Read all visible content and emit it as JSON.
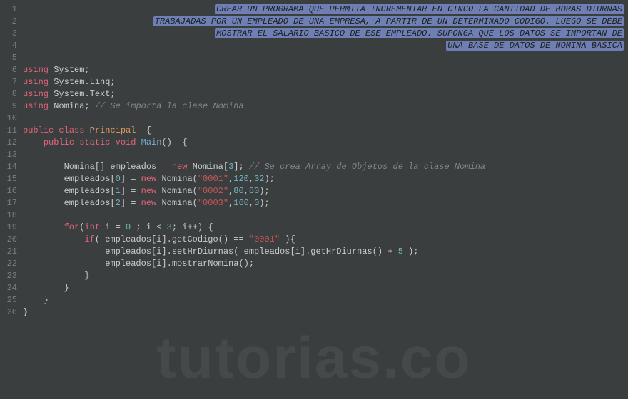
{
  "watermark": "tutorias.co",
  "lines": [
    {
      "num": "1",
      "type": "hl",
      "text": "CREAR UN PROGRAMA QUE PERMITA INCREMENTAR EN CINCO LA CANTIDAD DE HORAS DIURNAS"
    },
    {
      "num": "2",
      "type": "hl",
      "text": "TRABAJADAS POR UN EMPLEADO DE UNA EMPRESA, A PARTIR DE UN DETERMINADO CODIGO. LUEGO SE DEBE"
    },
    {
      "num": "3",
      "type": "hl",
      "text": "MOSTRAR EL SALARIO BASICO DE ESE EMPLEADO. SUPONGA QUE LOS DATOS SE IMPORTAN DE"
    },
    {
      "num": "4",
      "type": "hl",
      "text": "UNA BASE DE DATOS DE NOMINA BASICA"
    },
    {
      "num": "5",
      "type": "blank"
    },
    {
      "num": "6",
      "type": "code",
      "tokens": [
        {
          "c": "keyword",
          "t": "using"
        },
        {
          "c": "plain",
          "t": " System;"
        }
      ]
    },
    {
      "num": "7",
      "type": "code",
      "tokens": [
        {
          "c": "keyword",
          "t": "using"
        },
        {
          "c": "plain",
          "t": " System.Linq;"
        }
      ]
    },
    {
      "num": "8",
      "type": "code",
      "tokens": [
        {
          "c": "keyword",
          "t": "using"
        },
        {
          "c": "plain",
          "t": " System.Text;"
        }
      ]
    },
    {
      "num": "9",
      "type": "code",
      "tokens": [
        {
          "c": "keyword",
          "t": "using"
        },
        {
          "c": "plain",
          "t": " Nomina; "
        },
        {
          "c": "comment",
          "t": "// Se importa la clase Nomina"
        }
      ]
    },
    {
      "num": "10",
      "type": "blank"
    },
    {
      "num": "11",
      "type": "code",
      "tokens": [
        {
          "c": "keyword",
          "t": "public"
        },
        {
          "c": "plain",
          "t": " "
        },
        {
          "c": "keyword",
          "t": "class"
        },
        {
          "c": "plain",
          "t": " "
        },
        {
          "c": "class-name",
          "t": "Principal"
        },
        {
          "c": "plain",
          "t": "  {"
        }
      ]
    },
    {
      "num": "12",
      "type": "code",
      "tokens": [
        {
          "c": "plain",
          "t": "    "
        },
        {
          "c": "keyword",
          "t": "public"
        },
        {
          "c": "plain",
          "t": " "
        },
        {
          "c": "keyword",
          "t": "static"
        },
        {
          "c": "plain",
          "t": " "
        },
        {
          "c": "type",
          "t": "void"
        },
        {
          "c": "plain",
          "t": " "
        },
        {
          "c": "method-name",
          "t": "Main"
        },
        {
          "c": "plain",
          "t": "()  {"
        }
      ]
    },
    {
      "num": "13",
      "type": "blank"
    },
    {
      "num": "14",
      "type": "code",
      "tokens": [
        {
          "c": "plain",
          "t": "        Nomina[] empleados = "
        },
        {
          "c": "keyword",
          "t": "new"
        },
        {
          "c": "plain",
          "t": " Nomina["
        },
        {
          "c": "number",
          "t": "3"
        },
        {
          "c": "plain",
          "t": "]; "
        },
        {
          "c": "comment",
          "t": "// Se crea Array de Objetos de la clase Nomina"
        }
      ]
    },
    {
      "num": "15",
      "type": "code",
      "tokens": [
        {
          "c": "plain",
          "t": "        empleados["
        },
        {
          "c": "number",
          "t": "0"
        },
        {
          "c": "plain",
          "t": "] = "
        },
        {
          "c": "keyword",
          "t": "new"
        },
        {
          "c": "plain",
          "t": " Nomina("
        },
        {
          "c": "string",
          "t": "\"0001\""
        },
        {
          "c": "plain",
          "t": ","
        },
        {
          "c": "number",
          "t": "120"
        },
        {
          "c": "plain",
          "t": ","
        },
        {
          "c": "number",
          "t": "32"
        },
        {
          "c": "plain",
          "t": ");"
        }
      ]
    },
    {
      "num": "16",
      "type": "code",
      "tokens": [
        {
          "c": "plain",
          "t": "        empleados["
        },
        {
          "c": "number",
          "t": "1"
        },
        {
          "c": "plain",
          "t": "] = "
        },
        {
          "c": "keyword",
          "t": "new"
        },
        {
          "c": "plain",
          "t": " Nomina("
        },
        {
          "c": "string",
          "t": "\"0002\""
        },
        {
          "c": "plain",
          "t": ","
        },
        {
          "c": "number",
          "t": "80"
        },
        {
          "c": "plain",
          "t": ","
        },
        {
          "c": "number",
          "t": "80"
        },
        {
          "c": "plain",
          "t": ");"
        }
      ]
    },
    {
      "num": "17",
      "type": "code",
      "tokens": [
        {
          "c": "plain",
          "t": "        empleados["
        },
        {
          "c": "number",
          "t": "2"
        },
        {
          "c": "plain",
          "t": "] = "
        },
        {
          "c": "keyword",
          "t": "new"
        },
        {
          "c": "plain",
          "t": " Nomina("
        },
        {
          "c": "string",
          "t": "\"0003\""
        },
        {
          "c": "plain",
          "t": ","
        },
        {
          "c": "number",
          "t": "160"
        },
        {
          "c": "plain",
          "t": ","
        },
        {
          "c": "number",
          "t": "0"
        },
        {
          "c": "plain",
          "t": ");"
        }
      ]
    },
    {
      "num": "18",
      "type": "blank"
    },
    {
      "num": "19",
      "type": "code",
      "tokens": [
        {
          "c": "plain",
          "t": "        "
        },
        {
          "c": "keyword",
          "t": "for"
        },
        {
          "c": "plain",
          "t": "("
        },
        {
          "c": "type",
          "t": "int"
        },
        {
          "c": "plain",
          "t": " i = "
        },
        {
          "c": "number",
          "t": "0"
        },
        {
          "c": "plain",
          "t": " ; i < "
        },
        {
          "c": "number",
          "t": "3"
        },
        {
          "c": "plain",
          "t": "; i++) {"
        }
      ]
    },
    {
      "num": "20",
      "type": "code",
      "tokens": [
        {
          "c": "plain",
          "t": "            "
        },
        {
          "c": "keyword",
          "t": "if"
        },
        {
          "c": "plain",
          "t": "( empleados[i].getCodigo() == "
        },
        {
          "c": "string",
          "t": "\"0001\""
        },
        {
          "c": "plain",
          "t": " ){"
        }
      ]
    },
    {
      "num": "21",
      "type": "code",
      "tokens": [
        {
          "c": "plain",
          "t": "                empleados[i].setHrDiurnas( empleados[i].getHrDiurnas() + "
        },
        {
          "c": "number",
          "t": "5"
        },
        {
          "c": "plain",
          "t": " );"
        }
      ]
    },
    {
      "num": "22",
      "type": "code",
      "tokens": [
        {
          "c": "plain",
          "t": "                empleados[i].mostrarNomina();"
        }
      ]
    },
    {
      "num": "23",
      "type": "code",
      "tokens": [
        {
          "c": "plain",
          "t": "            }"
        }
      ]
    },
    {
      "num": "24",
      "type": "code",
      "tokens": [
        {
          "c": "plain",
          "t": "        }"
        }
      ]
    },
    {
      "num": "25",
      "type": "code",
      "tokens": [
        {
          "c": "plain",
          "t": "    }"
        }
      ]
    },
    {
      "num": "26",
      "type": "code",
      "tokens": [
        {
          "c": "plain",
          "t": "}"
        }
      ]
    }
  ]
}
